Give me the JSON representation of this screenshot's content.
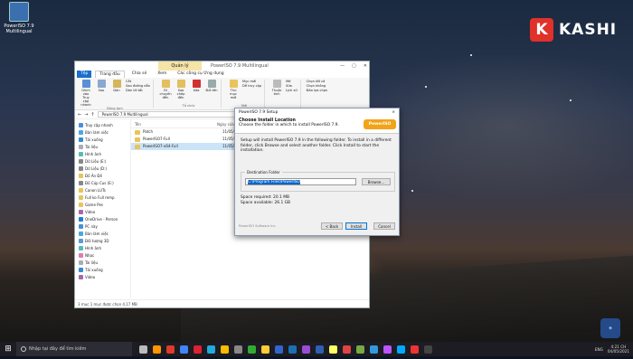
{
  "desktop": {
    "icon_label": "PowerISO 7.9 Multilingual"
  },
  "brand": {
    "letter": "K",
    "name": "KASHI"
  },
  "explorer": {
    "manage_tab": "Quản lý",
    "title": "PowerISO 7.9 Multilingual",
    "tabs": [
      "Tệp",
      "Trang đầu",
      "Chia sẻ",
      "Xem",
      "Các công cụ Ứng dụng"
    ],
    "ribbon": {
      "pin": "Ghim vào Truy cập nhanh",
      "copy": "Sao",
      "paste": "Dán",
      "cut": "Cắt",
      "copy_path": "Sao đường dẫn",
      "paste_shortcut": "Dán lối tắt",
      "clipboard": "Bảng tạm",
      "move_to": "Di chuyển đến",
      "copy_to": "Sao chép đến",
      "delete": "Xóa",
      "rename": "Đổi tên",
      "organize": "Tổ chức",
      "new_folder": "Thư mục mới",
      "new_item": "Mục mới",
      "easy_access": "Dễ truy cập",
      "new": "Mới",
      "properties": "Thuộc tính",
      "open": "Mở",
      "edit": "Sửa",
      "history": "Lịch sử",
      "select_all": "Chọn tất cả",
      "select_none": "Chọn không",
      "invert": "Đảo lựa chọn"
    },
    "path": "PowerISO 7.9 Multilingual",
    "nav": [
      "Truy cập nhanh",
      "Bàn làm việc",
      "Tải xuống",
      "Tài liệu",
      "Hình ảnh",
      "Dữ Liệu (E:)",
      "Dữ Liệu (D:)",
      "Đồ Án Đề",
      "Đồ Cúp Cus (E:)",
      "Canon LUTs",
      "Full ko Full remp",
      "Game Pes",
      "Video",
      "OneDrive - Person",
      "PC này",
      "Bàn làm việc",
      "Đối tượng 3D",
      "Hình ảnh",
      "Nhạc",
      "Tài liệu",
      "Tải xuống",
      "Video"
    ],
    "col_name": "Tên",
    "col_date": "Ngày sửa đổi",
    "files": [
      {
        "name": "Patch",
        "date": "11/05/2021"
      },
      {
        "name": "PowerISO7-Full",
        "date": "11/05/2021"
      },
      {
        "name": "PowerISO7-x64-Full",
        "date": "11/05/2021"
      }
    ],
    "status": "3 mục    1 mục được chọn  4,17 MB"
  },
  "dialog": {
    "title": "PowerISO 7.9 Setup",
    "close": "×",
    "heading": "Choose Install Location",
    "subheading": "Choose the folder in which to install PowerISO 7.9.",
    "logo": "PowerISO",
    "desc": "Setup will install PowerISO 7.9 in the following folder. To install in a different folder, click Browse and select another folder. Click Install to start the installation.",
    "dest_legend": "Destination Folder",
    "dest_value": "C:\\Program Files\\PowerISO",
    "browse": "Browse...",
    "space_req": "Space required: 20.1 MB",
    "space_avail": "Space available: 26.1 GB",
    "nsis": "PowerISO Software Inc.",
    "back": "< Back",
    "install": "Install",
    "cancel": "Cancel"
  },
  "taskbar": {
    "search": "Nhập tại đây để tìm kiếm",
    "lang": "ENG",
    "time": "4:21 CH",
    "date": "04/05/2021"
  },
  "colors": {
    "accent": "#1a6fc9",
    "brand_red": "#e0312a"
  }
}
